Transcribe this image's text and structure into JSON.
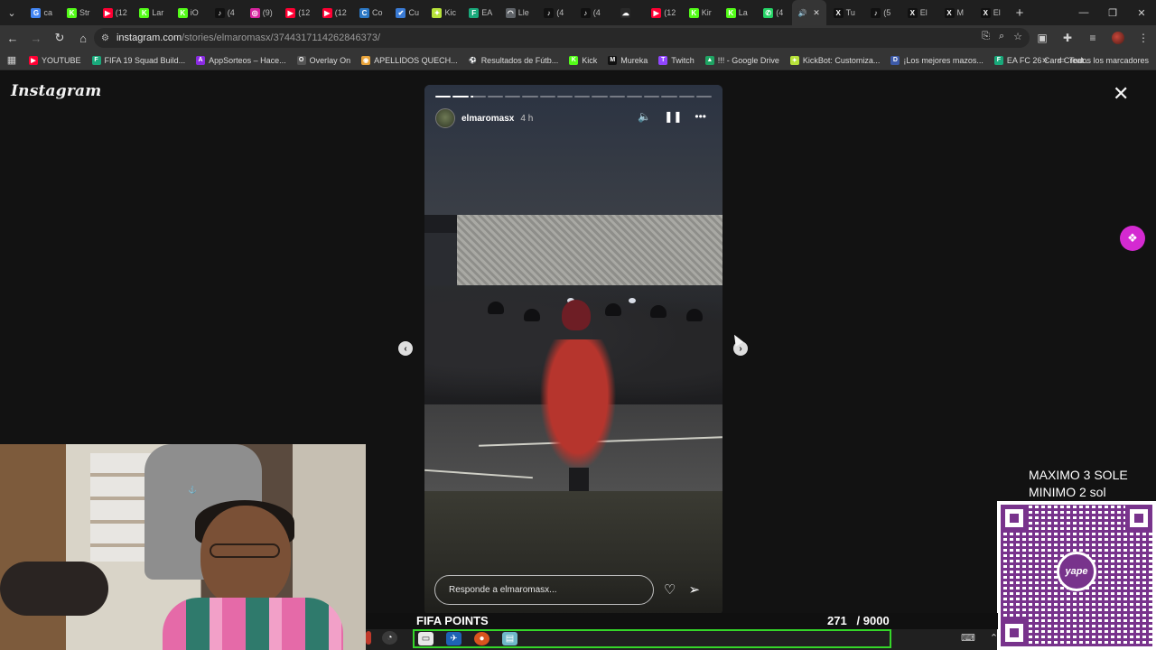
{
  "browser": {
    "tabs": [
      {
        "label": "ca",
        "icon": "google-icon",
        "color": "#4285f4",
        "glyph": "G"
      },
      {
        "label": "Str",
        "icon": "kick-icon",
        "color": "#53fc18",
        "glyph": "K"
      },
      {
        "label": "(12",
        "icon": "youtube-icon",
        "color": "#ff0033",
        "glyph": "▶"
      },
      {
        "label": "Lar",
        "icon": "kick-icon",
        "color": "#53fc18",
        "glyph": "K"
      },
      {
        "label": "iO",
        "icon": "kick-icon",
        "color": "#53fc18",
        "glyph": "K"
      },
      {
        "label": "(4",
        "icon": "tiktok-icon",
        "color": "#111111",
        "glyph": "♪"
      },
      {
        "label": "(9)",
        "icon": "instagram-icon",
        "color": "#d6249f",
        "glyph": "◎"
      },
      {
        "label": "(12",
        "icon": "youtube-icon",
        "color": "#ff0033",
        "glyph": "▶"
      },
      {
        "label": "(12",
        "icon": "youtube-icon",
        "color": "#ff0033",
        "glyph": "▶"
      },
      {
        "label": "Co",
        "icon": "copilot-icon",
        "color": "#2b78c5",
        "glyph": "C"
      },
      {
        "label": "Cu",
        "icon": "check-icon",
        "color": "#3a7bd5",
        "glyph": "✔"
      },
      {
        "label": "Kic",
        "icon": "kickbot-icon",
        "color": "#b7e23a",
        "glyph": "✦"
      },
      {
        "label": "EA",
        "icon": "futbin-icon",
        "color": "#19a97b",
        "glyph": "F"
      },
      {
        "label": "Lle",
        "icon": "chrome-icon",
        "color": "#5f6368",
        "glyph": "◠"
      },
      {
        "label": "(4",
        "icon": "tiktok-icon",
        "color": "#111111",
        "glyph": "♪"
      },
      {
        "label": "(4",
        "icon": "tiktok-icon",
        "color": "#111111",
        "glyph": "♪"
      },
      {
        "label": "",
        "icon": "cloud-icon",
        "color": "#2a2a2a",
        "glyph": "☁"
      },
      {
        "label": "(12",
        "icon": "youtube-icon",
        "color": "#ff0033",
        "glyph": "▶"
      },
      {
        "label": "Kir",
        "icon": "kick-icon",
        "color": "#53fc18",
        "glyph": "K"
      },
      {
        "label": "La",
        "icon": "kick-icon",
        "color": "#53fc18",
        "glyph": "K"
      },
      {
        "label": "(4",
        "icon": "whatsapp-icon",
        "color": "#25d366",
        "glyph": "✆"
      },
      {
        "label": "",
        "icon": "audio-icon",
        "color": "#353535",
        "glyph": "🔊",
        "active": true
      },
      {
        "label": "Tu",
        "icon": "x-icon",
        "color": "#111111",
        "glyph": "X"
      },
      {
        "label": "(5",
        "icon": "tiktok-icon",
        "color": "#111111",
        "glyph": "♪"
      },
      {
        "label": "El",
        "icon": "x-icon",
        "color": "#111111",
        "glyph": "X"
      },
      {
        "label": "M",
        "icon": "x-icon",
        "color": "#111111",
        "glyph": "X"
      },
      {
        "label": "El",
        "icon": "x-icon",
        "color": "#111111",
        "glyph": "X"
      }
    ],
    "url_host": "instagram.com",
    "url_path": "/stories/elmaromasx/3744317114262846373/",
    "bookmarks": [
      {
        "label": "YOUTUBE",
        "icon": "youtube-icon",
        "color": "#ff0033",
        "glyph": "▶"
      },
      {
        "label": "FIFA 19 Squad Build...",
        "icon": "futbin-icon",
        "color": "#19a97b",
        "glyph": "F"
      },
      {
        "label": "AppSorteos – Hace...",
        "icon": "appsorteos-icon",
        "color": "#8a2be2",
        "glyph": "A"
      },
      {
        "label": "Overlay On",
        "icon": "overlay-icon",
        "color": "#555555",
        "glyph": "O"
      },
      {
        "label": "APELLIDOS QUECH...",
        "icon": "chrome-icon",
        "color": "#e8a33a",
        "glyph": "◉"
      },
      {
        "label": "Resultados de Fútb...",
        "icon": "results-icon",
        "color": "#333333",
        "glyph": "⚽"
      },
      {
        "label": "Kick",
        "icon": "kick-icon",
        "color": "#53fc18",
        "glyph": "K"
      },
      {
        "label": "Mureka",
        "icon": "mureka-icon",
        "color": "#111111",
        "glyph": "M"
      },
      {
        "label": "Twitch",
        "icon": "twitch-icon",
        "color": "#9146ff",
        "glyph": "T"
      },
      {
        "label": "!!! - Google Drive",
        "icon": "drive-icon",
        "color": "#1fa463",
        "glyph": "▲"
      },
      {
        "label": "KickBot: Customiza...",
        "icon": "kickbot-icon",
        "color": "#b7e23a",
        "glyph": "✦"
      },
      {
        "label": "¡Los mejores mazos...",
        "icon": "deck-icon",
        "color": "#3d5aa8",
        "glyph": "D"
      },
      {
        "label": "EA FC 26 Card Creat...",
        "icon": "futbin-icon",
        "color": "#19a97b",
        "glyph": "F"
      }
    ],
    "bookmarks_folder": "Todos los marcadores"
  },
  "instagram": {
    "logo": "Instagram",
    "story": {
      "username": "elmaromasx",
      "time_ago": "4 h",
      "segments_total": 16,
      "current_segment": 3,
      "current_progress": 0.2,
      "reply_placeholder": "Responde a elmaromasx..."
    }
  },
  "overlay": {
    "donation_line1": "MAXIMO 3 SOLE",
    "donation_line2": "MINIMO 2 sol",
    "qr_brand": "yape",
    "goal_label": "FIFA POINTS",
    "goal_current": "271",
    "goal_target": "/ 9000"
  },
  "colors": {
    "instagram_bg": "#121212",
    "goal_border": "#35d629",
    "qr_purple": "#6a1d80",
    "side_button": "#d42ad1"
  }
}
